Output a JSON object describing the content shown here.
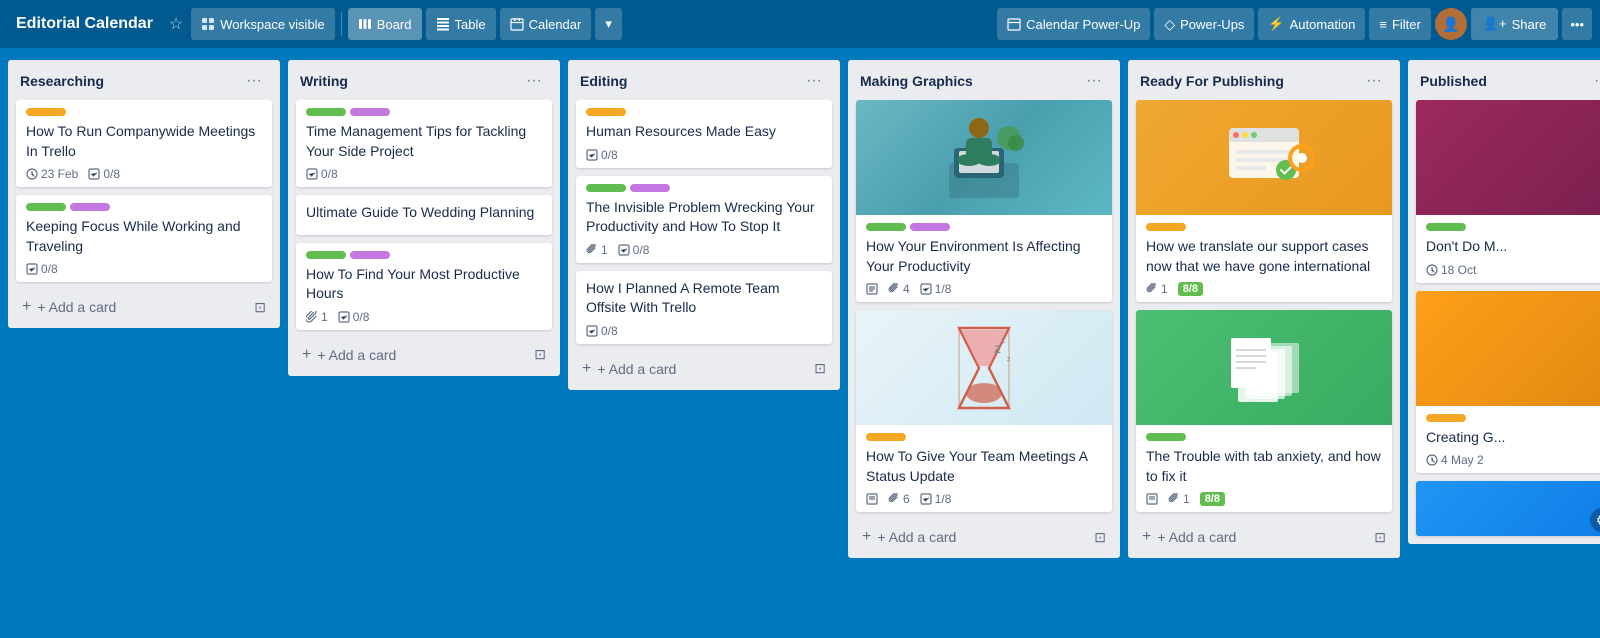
{
  "header": {
    "title": "Editorial Calendar",
    "workspace_label": "Workspace visible",
    "board_label": "Board",
    "table_label": "Table",
    "calendar_label": "Calendar",
    "calendar_powerup_label": "Calendar Power-Up",
    "powerups_label": "Power-Ups",
    "automation_label": "Automation",
    "filter_label": "Filter",
    "share_label": "Share"
  },
  "columns": [
    {
      "id": "researching",
      "title": "Researching",
      "cards": [
        {
          "id": "r1",
          "title": "How To Run Companywide Meetings In Trello",
          "labels": [
            "yellow"
          ],
          "meta": {
            "date": "23 Feb",
            "checklist": "0/8"
          }
        },
        {
          "id": "r2",
          "title": "Keeping Focus While Working and Traveling",
          "labels": [
            "green",
            "purple"
          ],
          "meta": {
            "checklist": "0/8"
          }
        }
      ]
    },
    {
      "id": "writing",
      "title": "Writing",
      "cards": [
        {
          "id": "w1",
          "title": "Time Management Tips for Tackling Your Side Project",
          "labels": [
            "green",
            "purple"
          ],
          "meta": {
            "checklist": "0/8"
          }
        },
        {
          "id": "w2",
          "title": "Ultimate Guide To Wedding Planning",
          "labels": [],
          "meta": {}
        },
        {
          "id": "w3",
          "title": "How To Find Your Most Productive Hours",
          "labels": [
            "green",
            "purple"
          ],
          "meta": {
            "attachments": "1",
            "checklist": "0/8"
          }
        }
      ]
    },
    {
      "id": "editing",
      "title": "Editing",
      "cards": [
        {
          "id": "e1",
          "title": "Human Resources Made Easy",
          "labels": [
            "yellow"
          ],
          "meta": {
            "checklist": "0/8"
          }
        },
        {
          "id": "e2",
          "title": "The Invisible Problem Wrecking Your Productivity and How To Stop It",
          "labels": [
            "green",
            "purple"
          ],
          "meta": {
            "attachments": "1",
            "checklist": "0/8"
          }
        },
        {
          "id": "e3",
          "title": "How I Planned A Remote Team Offsite With Trello",
          "labels": [],
          "meta": {
            "checklist": "0/8"
          }
        }
      ]
    },
    {
      "id": "making-graphics",
      "title": "Making Graphics",
      "cards": [
        {
          "id": "mg1",
          "title": "How Your Environment Is Affecting Your Productivity",
          "labels": [
            "green",
            "purple"
          ],
          "cover": "person",
          "meta": {
            "description": true,
            "attachments": "4",
            "checklist": "1/8"
          }
        },
        {
          "id": "mg2",
          "title": "How To Give Your Team Meetings A Status Update",
          "labels": [
            "yellow"
          ],
          "cover": "hourglass",
          "meta": {
            "description": true,
            "attachments": "6",
            "checklist": "1/8"
          }
        }
      ]
    },
    {
      "id": "ready-for-publishing",
      "title": "Ready For Publishing",
      "cards": [
        {
          "id": "rfp1",
          "title": "How we translate our support cases now that we have gone international",
          "labels": [
            "yellow"
          ],
          "cover": "orange-bg",
          "meta": {
            "attachments": "1",
            "checklist_done": "8/8"
          }
        },
        {
          "id": "rfp2",
          "title": "The Trouble with tab anxiety, and how to fix it",
          "labels": [
            "green"
          ],
          "cover": "green-bg",
          "meta": {
            "description": true,
            "attachments": "1",
            "checklist_done": "8/8"
          }
        }
      ]
    },
    {
      "id": "published",
      "title": "Published",
      "cards": [
        {
          "id": "pub1",
          "title": "Don't Do M...",
          "labels": [
            "green"
          ],
          "cover": "maroon-bg",
          "meta": {
            "date": "18 Oct"
          }
        },
        {
          "id": "pub2",
          "title": "Creating G...",
          "labels": [
            "yellow"
          ],
          "cover": "orange-bg2",
          "meta": {
            "date": "4 May 2"
          }
        },
        {
          "id": "pub3",
          "title": "",
          "labels": [],
          "cover": "blue-bg",
          "meta": {}
        }
      ]
    }
  ],
  "add_card_label": "+ Add a card"
}
